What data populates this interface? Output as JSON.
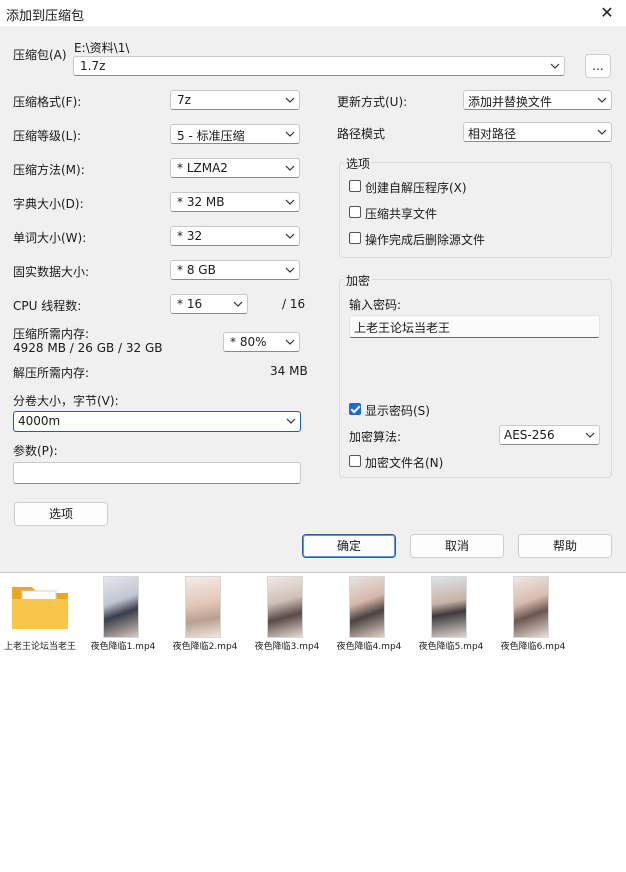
{
  "window": {
    "title": "添加到压缩包",
    "close_icon": "close-icon"
  },
  "archive": {
    "label": "压缩包(A)",
    "path": "E:\\资料\\1\\",
    "name": "1.7z",
    "browse_label": "..."
  },
  "left": {
    "format": {
      "label": "压缩格式(F):",
      "value": "7z"
    },
    "level": {
      "label": "压缩等级(L):",
      "value": "5 - 标准压缩"
    },
    "method": {
      "label": "压缩方法(M):",
      "value": "*  LZMA2"
    },
    "dict": {
      "label": "字典大小(D):",
      "value": "*  32 MB"
    },
    "word": {
      "label": "单词大小(W):",
      "value": "*  32"
    },
    "solid": {
      "label": "固实数据大小:",
      "value": "*  8 GB"
    },
    "cpu": {
      "label": "CPU 线程数:",
      "value": "*  16",
      "max": "/ 16"
    },
    "mem": {
      "label": "压缩所需内存:",
      "detail": "4928 MB / 26 GB / 32 GB",
      "value": "*  80%"
    },
    "decomp": {
      "label": "解压所需内存:",
      "value": "34 MB"
    },
    "volume": {
      "label": "分卷大小，字节(V):",
      "value": "4000m"
    },
    "params": {
      "label": "参数(P):",
      "value": ""
    },
    "options_button": "选项"
  },
  "right": {
    "update": {
      "label": "更新方式(U):",
      "value": "添加并替换文件"
    },
    "pathmode": {
      "label": "路径模式",
      "value": "相对路径"
    },
    "options_group": {
      "title": "选项",
      "sfx": "创建自解压程序(X)",
      "shared": "压缩共享文件",
      "delete": "操作完成后删除源文件"
    },
    "encrypt_group": {
      "title": "加密",
      "pw_label": "输入密码:",
      "pw_value": "上老王论坛当老王",
      "show_pw": "显示密码(S)",
      "method_label": "加密算法:",
      "method_value": "AES-256",
      "encrypt_names": "加密文件名(N)"
    }
  },
  "buttons": {
    "ok": "确定",
    "cancel": "取消",
    "help": "帮助"
  },
  "files": [
    {
      "name": "上老王论坛当老王",
      "type": "folder"
    },
    {
      "name": "夜色降临1.mp4",
      "type": "video"
    },
    {
      "name": "夜色降临2.mp4",
      "type": "video"
    },
    {
      "name": "夜色降临3.mp4",
      "type": "video"
    },
    {
      "name": "夜色降临4.mp4",
      "type": "video"
    },
    {
      "name": "夜色降临5.mp4",
      "type": "video"
    },
    {
      "name": "夜色降临6.mp4",
      "type": "video"
    }
  ]
}
